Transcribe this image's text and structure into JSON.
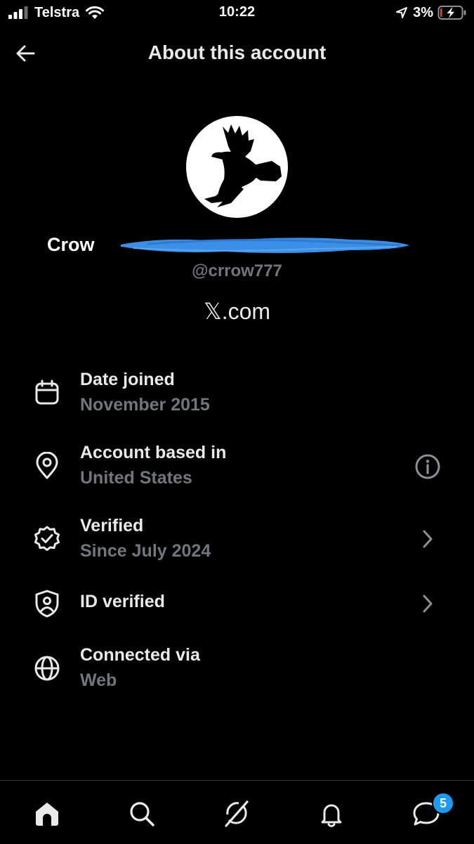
{
  "status_bar": {
    "carrier": "Telstra",
    "time": "10:22",
    "battery_percent": "3%"
  },
  "header": {
    "title": "About this account"
  },
  "profile": {
    "display_name": "Crow",
    "handle": "@crrow777",
    "platform": "𝕏.com"
  },
  "info_rows": [
    {
      "icon": "calendar-icon",
      "label": "Date joined",
      "value": "November 2015",
      "action": null
    },
    {
      "icon": "location-pin-icon",
      "label": "Account based in",
      "value": "United States",
      "action": "info-icon"
    },
    {
      "icon": "verified-badge-icon",
      "label": "Verified",
      "value": "Since July 2024",
      "action": "chevron-right-icon"
    },
    {
      "icon": "id-shield-icon",
      "label": "ID verified",
      "value": "",
      "action": "chevron-right-icon"
    },
    {
      "icon": "globe-icon",
      "label": "Connected via",
      "value": "Web",
      "action": null
    }
  ],
  "bottom_nav": {
    "items": [
      "home-icon",
      "search-icon",
      "grok-icon",
      "notifications-bell-icon",
      "messages-icon"
    ],
    "messages_badge": "5"
  },
  "colors": {
    "background": "#000000",
    "primary_text": "#e7e9ea",
    "secondary_text": "#71767b",
    "accent": "#1d9bf0",
    "redaction": "#3b8fe6"
  }
}
